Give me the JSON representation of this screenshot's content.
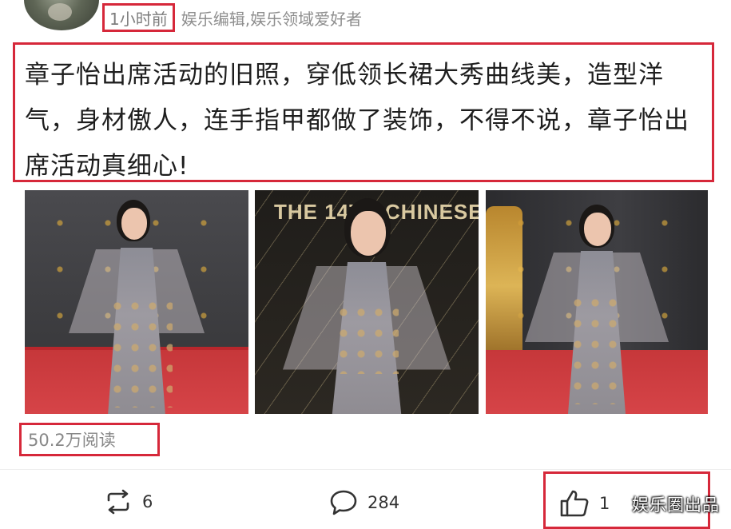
{
  "post": {
    "time": "1小时前",
    "author": "娱乐编辑,娱乐领域爱好者",
    "text": "章子怡出席活动的旧照，穿低领长裙大秀曲线美，造型洋气，身材傲人，连手指甲都做了装饰，不得不说，章子怡出席活动真细心!"
  },
  "photos": [
    {
      "name": "photo-red-carpet-left"
    },
    {
      "name": "photo-signature-wall",
      "banner": "THE 14TH CHINESE"
    },
    {
      "name": "photo-red-carpet-right"
    }
  ],
  "stats": {
    "reads": "50.2万阅读"
  },
  "actions": {
    "repost_count": "6",
    "comment_count": "284",
    "like_count": "1"
  },
  "watermark": "娱乐圈出品",
  "colors": {
    "highlight_border": "#d6283a",
    "muted_text": "#8a8a8a"
  }
}
